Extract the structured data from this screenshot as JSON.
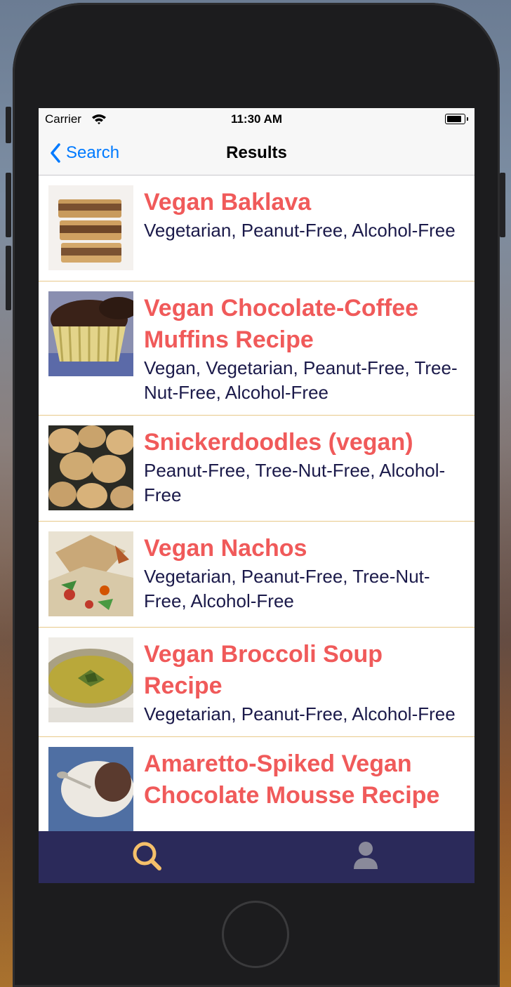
{
  "status_bar": {
    "carrier": "Carrier",
    "time": "11:30 AM"
  },
  "nav": {
    "back_label": "Search",
    "title": "Results"
  },
  "recipes": [
    {
      "title": "Vegan Baklava",
      "labels": " Vegetarian, Peanut-Free, Alcohol-Free"
    },
    {
      "title": "Vegan Chocolate-Coffee Muffins Recipe",
      "labels": " Vegan, Vegetarian, Peanut-Free, Tree-Nut-Free, Alcohol-Free"
    },
    {
      "title": "Snickerdoodles (vegan)",
      "labels": " Peanut-Free, Tree-Nut-Free, Alcohol-Free"
    },
    {
      "title": "Vegan Nachos",
      "labels": " Vegetarian, Peanut-Free, Tree-Nut-Free, Alcohol-Free"
    },
    {
      "title": "Vegan Broccoli Soup Recipe",
      "labels": " Vegetarian, Peanut-Free, Alcohol-Free"
    },
    {
      "title": "Amaretto-Spiked Vegan Chocolate Mousse Recipe",
      "labels": ""
    }
  ],
  "tab_bar": {
    "tabs": [
      {
        "icon": "search-icon",
        "active": true
      },
      {
        "icon": "user-icon",
        "active": false
      }
    ]
  },
  "colors": {
    "accent": "#007aff",
    "title_red": "#f05a5a",
    "label_navy": "#1b1a4a",
    "tab_bar_bg": "#2b2a5a",
    "tab_active": "#f5c06a",
    "tab_inactive": "#8a8a9a",
    "separator": "#e8c98a"
  }
}
